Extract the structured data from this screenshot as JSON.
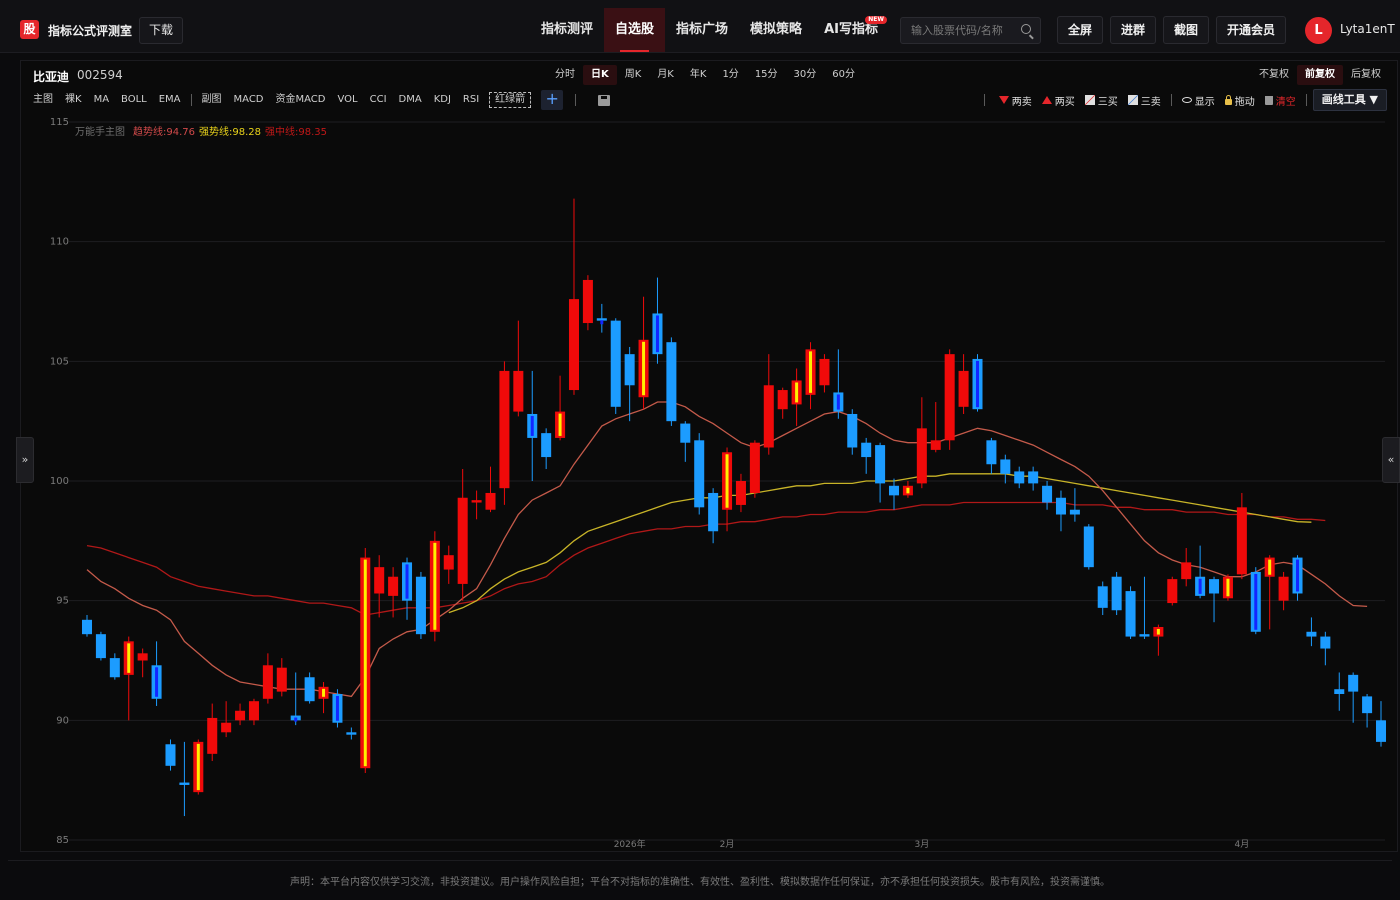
{
  "app": {
    "logo_text": "股",
    "brand": "指标公式评测室",
    "download_label": "下载"
  },
  "nav": {
    "items": [
      {
        "label": "指标测评",
        "active": false
      },
      {
        "label": "自选股",
        "active": true
      },
      {
        "label": "指标广场",
        "active": false
      },
      {
        "label": "模拟策略",
        "active": false
      },
      {
        "label": "AI写指标",
        "active": false,
        "badge": "NEW"
      }
    ]
  },
  "search": {
    "placeholder": "输入股票代码/名称"
  },
  "header_buttons": {
    "fullscreen": "全屏",
    "join_group": "进群",
    "screenshot": "截图",
    "membership": "开通会员"
  },
  "user": {
    "avatar_letter": "L",
    "name": "Lyta1enT"
  },
  "stock": {
    "name": "比亚迪",
    "code": "002594"
  },
  "periods": [
    {
      "label": "分时",
      "active": false
    },
    {
      "label": "日K",
      "active": true
    },
    {
      "label": "周K",
      "active": false
    },
    {
      "label": "月K",
      "active": false
    },
    {
      "label": "年K",
      "active": false
    },
    {
      "label": "1分",
      "active": false
    },
    {
      "label": "15分",
      "active": false
    },
    {
      "label": "30分",
      "active": false
    },
    {
      "label": "60分",
      "active": false
    }
  ],
  "adjust": [
    {
      "label": "不复权",
      "active": false
    },
    {
      "label": "前复权",
      "active": true
    },
    {
      "label": "后复权",
      "active": false
    }
  ],
  "indicators_main": [
    "主图",
    "裸K",
    "MA",
    "BOLL",
    "EMA"
  ],
  "indicators_sub": [
    "副图",
    "MACD",
    "资金MACD",
    "VOL",
    "CCI",
    "DMA",
    "KDJ",
    "RSI"
  ],
  "indicator_dashed": "红绿箭",
  "plus_label": "+",
  "draw_tools": {
    "two_sell": "两卖",
    "two_buy": "两买",
    "three_buy": "三买",
    "three_sell": "三卖",
    "show": "显示",
    "drag": "拖动",
    "clear": "清空",
    "draw_button": "画线工具 ▼"
  },
  "legend": {
    "main": "万能手主图",
    "trend": "趋势线:94.76",
    "strong": "强势线:98.28",
    "strong_mid": "强中线:98.35"
  },
  "side_tabs": {
    "left": "»",
    "right": "«"
  },
  "disclaimer": "声明：本平台内容仅供学习交流，非投资建议。用户操作风险自担；平台不对指标的准确性、有效性、盈利性、模拟数据作任何保证，亦不承担任何投资损失。股市有风险，投资需谨慎。",
  "colors": {
    "up": "#f00a0a",
    "down": "#1c9cff",
    "accent": "#e5262b",
    "trend_line": "#c45a4a",
    "strong_line": "#c8b428",
    "strong_mid_line": "#b01818",
    "signal_yellow": "#ffee00",
    "signal_blue": "#1226ff"
  },
  "chart_data": {
    "type": "candlestick",
    "ylim": [
      85,
      115
    ],
    "y_ticks": [
      85,
      90,
      95,
      100,
      105,
      110,
      115
    ],
    "x_labels": [
      {
        "label": "2026年",
        "index": 39
      },
      {
        "label": "2月",
        "index": 46
      },
      {
        "label": "3月",
        "index": 60
      },
      {
        "label": "4月",
        "index": 83
      }
    ],
    "candles": [
      {
        "o": 94.2,
        "c": 93.6,
        "h": 94.4,
        "l": 93.5
      },
      {
        "o": 93.6,
        "c": 92.6,
        "h": 93.7,
        "l": 92.5
      },
      {
        "o": 92.6,
        "c": 91.8,
        "h": 92.8,
        "l": 91.7
      },
      {
        "o": 91.9,
        "c": 93.3,
        "h": 93.5,
        "l": 90.0,
        "sig": "y"
      },
      {
        "o": 92.5,
        "c": 92.8,
        "h": 93.0,
        "l": 91.8
      },
      {
        "o": 92.3,
        "c": 90.9,
        "h": 93.3,
        "l": 90.6,
        "sig": "b"
      },
      {
        "o": 89.0,
        "c": 88.1,
        "h": 89.2,
        "l": 87.9
      },
      {
        "o": 87.4,
        "c": 87.3,
        "h": 89.1,
        "l": 86.0
      },
      {
        "o": 87.0,
        "c": 89.1,
        "h": 89.2,
        "l": 86.9,
        "sig": "y"
      },
      {
        "o": 88.6,
        "c": 90.1,
        "h": 90.7,
        "l": 88.3
      },
      {
        "o": 89.5,
        "c": 89.9,
        "h": 90.8,
        "l": 89.3
      },
      {
        "o": 90.0,
        "c": 90.4,
        "h": 90.7,
        "l": 89.8
      },
      {
        "o": 90.0,
        "c": 90.8,
        "h": 90.9,
        "l": 89.8
      },
      {
        "o": 90.9,
        "c": 92.3,
        "h": 92.8,
        "l": 90.7
      },
      {
        "o": 91.2,
        "c": 92.2,
        "h": 92.6,
        "l": 91.0
      },
      {
        "o": 90.2,
        "c": 90.0,
        "h": 92.0,
        "l": 89.8,
        "sig": "b"
      },
      {
        "o": 91.8,
        "c": 90.8,
        "h": 92.0,
        "l": 90.7
      },
      {
        "o": 90.9,
        "c": 91.4,
        "h": 91.6,
        "l": 90.3,
        "sig": "y"
      },
      {
        "o": 91.1,
        "c": 89.9,
        "h": 91.3,
        "l": 89.7,
        "sig": "b"
      },
      {
        "o": 89.5,
        "c": 89.4,
        "h": 89.7,
        "l": 89.2
      },
      {
        "o": 88.0,
        "c": 96.8,
        "h": 97.2,
        "l": 87.8,
        "sig": "y"
      },
      {
        "o": 95.3,
        "c": 96.4,
        "h": 96.9,
        "l": 94.3
      },
      {
        "o": 95.2,
        "c": 96.0,
        "h": 96.4,
        "l": 94.3
      },
      {
        "o": 96.6,
        "c": 95.0,
        "h": 96.8,
        "l": 94.2,
        "sig": "b"
      },
      {
        "o": 96.0,
        "c": 93.6,
        "h": 96.2,
        "l": 93.4
      },
      {
        "o": 93.7,
        "c": 97.5,
        "h": 97.9,
        "l": 93.3,
        "sig": "y"
      },
      {
        "o": 96.3,
        "c": 96.9,
        "h": 97.3,
        "l": 95.7
      },
      {
        "o": 95.7,
        "c": 99.3,
        "h": 100.5,
        "l": 95.0
      },
      {
        "o": 99.1,
        "c": 99.2,
        "h": 99.6,
        "l": 98.4
      },
      {
        "o": 98.8,
        "c": 99.5,
        "h": 100.6,
        "l": 98.7
      },
      {
        "o": 99.7,
        "c": 104.6,
        "h": 105.0,
        "l": 99.0
      },
      {
        "o": 102.9,
        "c": 104.6,
        "h": 106.7,
        "l": 102.7
      },
      {
        "o": 102.8,
        "c": 101.8,
        "h": 104.6,
        "l": 100.0,
        "sig": "b"
      },
      {
        "o": 102.0,
        "c": 101.0,
        "h": 102.2,
        "l": 100.5
      },
      {
        "o": 101.8,
        "c": 102.9,
        "h": 104.4,
        "l": 101.7,
        "sig": "y"
      },
      {
        "o": 103.8,
        "c": 107.6,
        "h": 111.8,
        "l": 103.6
      },
      {
        "o": 106.6,
        "c": 108.4,
        "h": 108.6,
        "l": 106.3
      },
      {
        "o": 106.8,
        "c": 106.7,
        "h": 107.4,
        "l": 106.2,
        "sig": "b"
      },
      {
        "o": 106.7,
        "c": 103.1,
        "h": 106.8,
        "l": 102.8
      },
      {
        "o": 105.3,
        "c": 104.0,
        "h": 105.6,
        "l": 102.5
      },
      {
        "o": 103.5,
        "c": 105.9,
        "h": 107.7,
        "l": 103.0,
        "sig": "y"
      },
      {
        "o": 107.0,
        "c": 105.3,
        "h": 108.5,
        "l": 104.9,
        "sig": "b"
      },
      {
        "o": 105.8,
        "c": 102.5,
        "h": 106.0,
        "l": 102.3
      },
      {
        "o": 102.4,
        "c": 101.6,
        "h": 102.5,
        "l": 100.8
      },
      {
        "o": 101.7,
        "c": 98.9,
        "h": 102.0,
        "l": 98.6
      },
      {
        "o": 99.5,
        "c": 97.9,
        "h": 99.7,
        "l": 97.4
      },
      {
        "o": 98.8,
        "c": 101.2,
        "h": 101.4,
        "l": 97.9,
        "sig": "y"
      },
      {
        "o": 99.0,
        "c": 100.0,
        "h": 100.3,
        "l": 98.7
      },
      {
        "o": 99.5,
        "c": 101.6,
        "h": 101.7,
        "l": 99.3
      },
      {
        "o": 101.4,
        "c": 104.0,
        "h": 105.3,
        "l": 101.1
      },
      {
        "o": 103.0,
        "c": 103.8,
        "h": 103.9,
        "l": 102.6
      },
      {
        "o": 103.2,
        "c": 104.2,
        "h": 104.7,
        "l": 102.3,
        "sig": "y"
      },
      {
        "o": 103.6,
        "c": 105.5,
        "h": 105.8,
        "l": 103.0,
        "sig": "y"
      },
      {
        "o": 104.0,
        "c": 105.1,
        "h": 105.3,
        "l": 103.7
      },
      {
        "o": 103.7,
        "c": 102.9,
        "h": 105.5,
        "l": 102.6,
        "sig": "b"
      },
      {
        "o": 102.8,
        "c": 101.4,
        "h": 103.0,
        "l": 101.1
      },
      {
        "o": 101.6,
        "c": 101.0,
        "h": 101.8,
        "l": 100.3
      },
      {
        "o": 101.5,
        "c": 99.9,
        "h": 101.6,
        "l": 99.1
      },
      {
        "o": 99.8,
        "c": 99.4,
        "h": 100.1,
        "l": 98.8
      },
      {
        "o": 99.4,
        "c": 99.8,
        "h": 100.0,
        "l": 99.3,
        "sig": "y"
      },
      {
        "o": 99.9,
        "c": 102.2,
        "h": 103.5,
        "l": 99.7
      },
      {
        "o": 101.3,
        "c": 101.7,
        "h": 103.3,
        "l": 101.2
      },
      {
        "o": 101.7,
        "c": 105.3,
        "h": 105.5,
        "l": 101.3
      },
      {
        "o": 103.1,
        "c": 104.6,
        "h": 105.3,
        "l": 102.8
      },
      {
        "o": 105.1,
        "c": 103.0,
        "h": 105.3,
        "l": 102.9,
        "sig": "b"
      },
      {
        "o": 101.7,
        "c": 100.7,
        "h": 101.8,
        "l": 100.3
      },
      {
        "o": 100.9,
        "c": 100.3,
        "h": 101.1,
        "l": 99.9
      },
      {
        "o": 100.4,
        "c": 99.9,
        "h": 100.6,
        "l": 99.7
      },
      {
        "o": 100.4,
        "c": 99.9,
        "h": 100.6,
        "l": 99.6
      },
      {
        "o": 99.8,
        "c": 99.1,
        "h": 100.0,
        "l": 98.8
      },
      {
        "o": 99.3,
        "c": 98.6,
        "h": 99.6,
        "l": 97.9
      },
      {
        "o": 98.8,
        "c": 98.6,
        "h": 99.7,
        "l": 98.3
      },
      {
        "o": 98.1,
        "c": 96.4,
        "h": 98.2,
        "l": 96.3
      },
      {
        "o": 95.6,
        "c": 94.7,
        "h": 95.8,
        "l": 94.4
      },
      {
        "o": 96.0,
        "c": 94.6,
        "h": 96.2,
        "l": 94.4
      },
      {
        "o": 95.4,
        "c": 93.5,
        "h": 95.6,
        "l": 93.4
      },
      {
        "o": 93.6,
        "c": 93.5,
        "h": 96.0,
        "l": 93.4
      },
      {
        "o": 93.5,
        "c": 93.9,
        "h": 94.0,
        "l": 92.7,
        "sig": "y"
      },
      {
        "o": 94.9,
        "c": 95.9,
        "h": 96.0,
        "l": 94.8
      },
      {
        "o": 95.9,
        "c": 96.6,
        "h": 97.2,
        "l": 95.6
      },
      {
        "o": 96.0,
        "c": 95.2,
        "h": 97.3,
        "l": 95.1,
        "sig": "b"
      },
      {
        "o": 95.9,
        "c": 95.3,
        "h": 96.0,
        "l": 94.1
      },
      {
        "o": 95.1,
        "c": 96.0,
        "h": 96.1,
        "l": 95.0,
        "sig": "y"
      },
      {
        "o": 96.1,
        "c": 98.9,
        "h": 99.5,
        "l": 95.9
      },
      {
        "o": 96.2,
        "c": 93.7,
        "h": 96.4,
        "l": 93.6,
        "sig": "b"
      },
      {
        "o": 96.0,
        "c": 96.8,
        "h": 96.9,
        "l": 93.8,
        "sig": "y"
      },
      {
        "o": 95.0,
        "c": 96.0,
        "h": 96.2,
        "l": 94.6
      },
      {
        "o": 96.8,
        "c": 95.3,
        "h": 96.9,
        "l": 95.0,
        "sig": "b"
      },
      {
        "o": 93.7,
        "c": 93.5,
        "h": 94.3,
        "l": 93.1
      },
      {
        "o": 93.5,
        "c": 93.0,
        "h": 93.7,
        "l": 92.3
      },
      {
        "o": 91.3,
        "c": 91.1,
        "h": 92.0,
        "l": 90.4
      },
      {
        "o": 91.9,
        "c": 91.2,
        "h": 92.0,
        "l": 89.9
      },
      {
        "o": 91.0,
        "c": 90.3,
        "h": 91.1,
        "l": 89.7
      },
      {
        "o": 90.0,
        "c": 89.1,
        "h": 90.8,
        "l": 88.9
      }
    ],
    "trend_line": [
      96.3,
      95.8,
      95.5,
      95.1,
      94.8,
      94.6,
      94.2,
      93.3,
      92.8,
      92.3,
      91.9,
      91.6,
      91.5,
      91.4,
      91.3,
      91.3,
      91.3,
      91.2,
      91.1,
      91.0,
      91.8,
      93.0,
      93.4,
      93.7,
      93.8,
      94.2,
      94.6,
      95.1,
      95.5,
      96.5,
      97.6,
      98.6,
      99.2,
      99.5,
      99.8,
      100.7,
      101.5,
      102.3,
      102.6,
      102.8,
      103.0,
      103.3,
      103.3,
      103.1,
      102.7,
      102.4,
      102.0,
      101.6,
      101.4,
      101.6,
      101.9,
      102.2,
      102.5,
      102.8,
      102.9,
      102.7,
      102.4,
      102.0,
      101.7,
      101.6,
      101.6,
      101.6,
      101.8,
      102.0,
      102.2,
      102.1,
      101.9,
      101.7,
      101.5,
      101.2,
      100.9,
      100.6,
      100.2,
      99.6,
      98.9,
      98.2,
      97.5,
      97.0,
      96.7,
      96.5,
      96.4,
      96.2,
      96.0,
      96.0,
      96.2,
      96.5,
      96.6,
      96.5,
      96.1,
      95.7,
      95.2,
      94.8,
      94.76
    ],
    "strong_line": [
      null,
      null,
      null,
      null,
      null,
      null,
      null,
      null,
      null,
      null,
      null,
      null,
      null,
      null,
      null,
      null,
      null,
      null,
      null,
      null,
      null,
      null,
      null,
      null,
      null,
      null,
      94.5,
      94.7,
      95.0,
      95.5,
      95.9,
      96.2,
      96.4,
      96.6,
      97.0,
      97.5,
      97.9,
      98.1,
      98.3,
      98.5,
      98.7,
      98.9,
      99.1,
      99.2,
      99.3,
      99.3,
      99.4,
      99.4,
      99.5,
      99.6,
      99.7,
      99.8,
      99.8,
      99.9,
      99.9,
      99.9,
      100.0,
      100.0,
      100.0,
      100.1,
      100.2,
      100.2,
      100.3,
      100.3,
      100.3,
      100.3,
      100.3,
      100.2,
      100.2,
      100.1,
      100.0,
      99.9,
      99.8,
      99.7,
      99.6,
      99.5,
      99.4,
      99.3,
      99.2,
      99.1,
      99.0,
      98.9,
      98.8,
      98.7,
      98.6,
      98.5,
      98.4,
      98.3,
      98.28
    ],
    "strong_mid_line": [
      97.3,
      97.2,
      97.0,
      96.8,
      96.6,
      96.4,
      96.0,
      95.8,
      95.6,
      95.5,
      95.4,
      95.3,
      95.2,
      95.2,
      95.1,
      95.0,
      94.9,
      94.9,
      94.8,
      94.7,
      94.4,
      94.5,
      94.6,
      94.7,
      94.7,
      94.7,
      94.8,
      94.9,
      95.0,
      95.2,
      95.5,
      95.7,
      95.8,
      96.0,
      96.5,
      96.9,
      97.2,
      97.4,
      97.6,
      97.8,
      97.9,
      98.0,
      98.0,
      98.1,
      98.1,
      98.2,
      98.2,
      98.3,
      98.3,
      98.4,
      98.5,
      98.5,
      98.6,
      98.6,
      98.7,
      98.7,
      98.7,
      98.8,
      98.8,
      98.9,
      99.0,
      99.0,
      99.0,
      99.1,
      99.1,
      99.1,
      99.1,
      99.1,
      99.1,
      99.1,
      99.1,
      99.0,
      99.0,
      99.0,
      98.9,
      98.9,
      98.8,
      98.8,
      98.8,
      98.7,
      98.7,
      98.7,
      98.6,
      98.6,
      98.6,
      98.5,
      98.5,
      98.4,
      98.4,
      98.35
    ]
  }
}
